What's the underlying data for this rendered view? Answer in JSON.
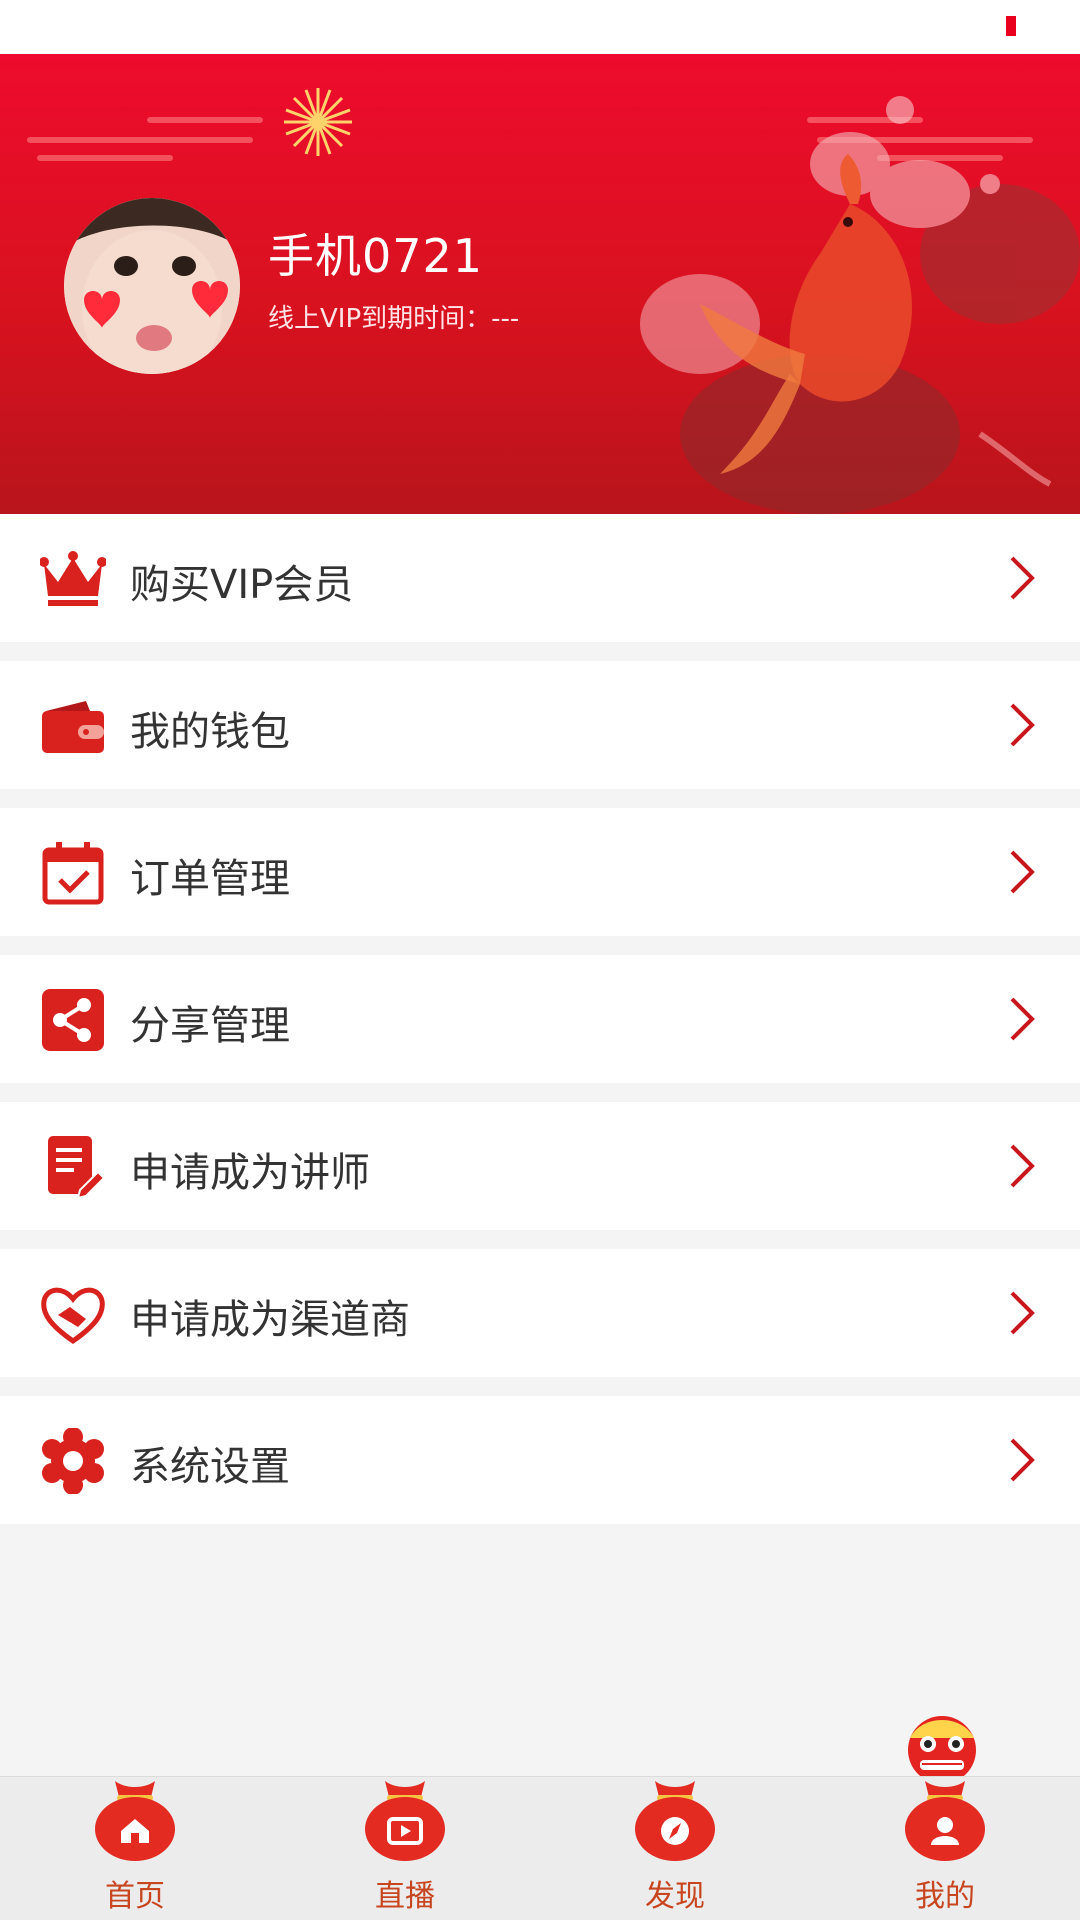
{
  "profile": {
    "username": "手机0721",
    "vip_expire": "线上VIP到期时间：---"
  },
  "menu": {
    "items": [
      {
        "label": "购买VIP会员",
        "icon": "crown-icon"
      },
      {
        "label": "我的钱包",
        "icon": "wallet-icon"
      },
      {
        "label": "订单管理",
        "icon": "calendar-check-icon"
      },
      {
        "label": "分享管理",
        "icon": "share-icon"
      },
      {
        "label": "申请成为讲师",
        "icon": "document-edit-icon"
      },
      {
        "label": "申请成为渠道商",
        "icon": "handshake-heart-icon"
      },
      {
        "label": "系统设置",
        "icon": "gear-icon"
      }
    ]
  },
  "tabbar": {
    "tabs": [
      {
        "label": "首页",
        "icon": "home-icon"
      },
      {
        "label": "直播",
        "icon": "play-icon"
      },
      {
        "label": "发现",
        "icon": "compass-icon"
      },
      {
        "label": "我的",
        "icon": "user-icon"
      }
    ],
    "active": "我的"
  },
  "colors": {
    "accent": "#d8121f",
    "header_top": "#ee0b2d",
    "icon_red": "#d9221e",
    "tab_label": "#c8461f"
  }
}
